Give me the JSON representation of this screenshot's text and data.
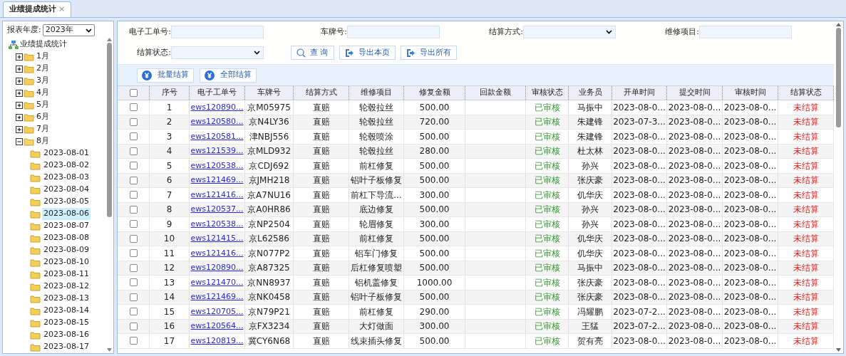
{
  "tabs": [
    {
      "label": "业绩提成统计",
      "close": "×",
      "selected": true
    }
  ],
  "sidebar": {
    "year_label": "报表年度:",
    "year_value": "2023年",
    "tree": {
      "label": "业绩提成统计",
      "selected": false,
      "children": [
        {
          "label": "1月",
          "expanded": false,
          "selected": false
        },
        {
          "label": "2月",
          "expanded": false,
          "selected": false
        },
        {
          "label": "3月",
          "expanded": false,
          "selected": false
        },
        {
          "label": "4月",
          "expanded": false,
          "selected": false
        },
        {
          "label": "5月",
          "expanded": false,
          "selected": false
        },
        {
          "label": "6月",
          "expanded": false,
          "selected": false
        },
        {
          "label": "7月",
          "expanded": false,
          "selected": false
        },
        {
          "label": "8月",
          "expanded": true,
          "selected": false,
          "children": [
            {
              "label": "2023-08-01",
              "selected": false
            },
            {
              "label": "2023-08-02",
              "selected": false
            },
            {
              "label": "2023-08-03",
              "selected": false
            },
            {
              "label": "2023-08-04",
              "selected": false
            },
            {
              "label": "2023-08-05",
              "selected": false
            },
            {
              "label": "2023-08-06",
              "selected": true
            },
            {
              "label": "2023-08-07",
              "selected": false
            },
            {
              "label": "2023-08-08",
              "selected": false
            },
            {
              "label": "2023-08-09",
              "selected": false
            },
            {
              "label": "2023-08-10",
              "selected": false
            },
            {
              "label": "2023-08-11",
              "selected": false
            },
            {
              "label": "2023-08-12",
              "selected": false
            },
            {
              "label": "2023-08-13",
              "selected": false
            },
            {
              "label": "2023-08-14",
              "selected": false
            },
            {
              "label": "2023-08-15",
              "selected": false
            },
            {
              "label": "2023-08-16",
              "selected": false
            },
            {
              "label": "2023-08-17",
              "selected": false
            }
          ]
        }
      ]
    }
  },
  "filters": [
    {
      "label": "电子工单号:",
      "kind": "text"
    },
    {
      "label": "车牌号:",
      "kind": "text"
    },
    {
      "label": "结算方式:",
      "kind": "select"
    },
    {
      "label": "维修项目:",
      "kind": "text"
    },
    {
      "label": "结算状态:",
      "kind": "select"
    }
  ],
  "filter_buttons": [
    {
      "label": "查 询",
      "kind": "search"
    },
    {
      "label": "导出本页",
      "kind": "export"
    },
    {
      "label": "导出所有",
      "kind": "export"
    }
  ],
  "toolbar": [
    {
      "label": "批量结算"
    },
    {
      "label": "全部结算"
    }
  ],
  "table": {
    "select_all_checked": false,
    "columns": [
      "序号",
      "电子工单号",
      "车牌号",
      "结算方式",
      "维修项目",
      "修复金额",
      "回款金额",
      "审核状态",
      "业务员",
      "开单时间",
      "提交时间",
      "审核时间",
      "结算状态"
    ],
    "rows": [
      {
        "checked": false,
        "cells": [
          "1",
          "ews120890...",
          "京M05975",
          "直赔",
          "轮毂拉丝",
          "500.00",
          "",
          "已审核",
          "马振中",
          "2023-08-0...",
          "2023-08-0...",
          "2023-08-0...",
          "未结算"
        ]
      },
      {
        "checked": false,
        "cells": [
          "2",
          "ews120580...",
          "京N4LY36",
          "直赔",
          "轮毂拉丝",
          "720.00",
          "",
          "已审核",
          "朱建锋",
          "2023-07-3...",
          "2023-08-0...",
          "2023-08-0...",
          "未结算"
        ]
      },
      {
        "checked": false,
        "cells": [
          "3",
          "ews120581...",
          "津NBJ556",
          "直赔",
          "轮毂喷涂",
          "500.00",
          "",
          "已审核",
          "朱建锋",
          "2023-08-0...",
          "2023-08-0...",
          "2023-08-0...",
          "未结算"
        ]
      },
      {
        "checked": false,
        "cells": [
          "4",
          "ews121539...",
          "京MLD932",
          "直赔",
          "轮毂拉丝",
          "280.00",
          "",
          "已审核",
          "杜太林",
          "2023-08-0...",
          "2023-08-0...",
          "2023-08-0...",
          "未结算"
        ]
      },
      {
        "checked": false,
        "cells": [
          "5",
          "ews120538...",
          "京CDJ692",
          "直赔",
          "前杠修复",
          "500.00",
          "",
          "已审核",
          "孙兴",
          "2023-08-0...",
          "2023-08-0...",
          "2023-08-0...",
          "未结算"
        ]
      },
      {
        "checked": false,
        "cells": [
          "6",
          "ews121469...",
          "京JMH218",
          "直赔",
          "铝叶子板修复",
          "500.00",
          "",
          "已审核",
          "张庆豪",
          "2023-08-0...",
          "2023-08-0...",
          "2023-08-0...",
          "未结算"
        ]
      },
      {
        "checked": false,
        "cells": [
          "7",
          "ews121416...",
          "京A7NU16",
          "直赔",
          "前杠下导流...",
          "300.00",
          "",
          "已审核",
          "仉华庆",
          "2023-08-0...",
          "2023-08-0...",
          "2023-08-0...",
          "未结算"
        ]
      },
      {
        "checked": false,
        "cells": [
          "8",
          "ews120537...",
          "京A0HR86",
          "直赔",
          "底边修复",
          "500.00",
          "",
          "已审核",
          "孙兴",
          "2023-08-0...",
          "2023-08-0...",
          "2023-08-0...",
          "未结算"
        ]
      },
      {
        "checked": false,
        "cells": [
          "9",
          "ews120538...",
          "京NP2504",
          "直赔",
          "轮眉修复",
          "300.00",
          "",
          "已审核",
          "孙兴",
          "2023-08-0...",
          "2023-08-0...",
          "2023-08-0...",
          "未结算"
        ]
      },
      {
        "checked": false,
        "cells": [
          "10",
          "ews121415...",
          "京L62586",
          "直赔",
          "前杠修复",
          "500.00",
          "",
          "已审核",
          "仉华庆",
          "2023-08-0...",
          "2023-08-0...",
          "2023-08-0...",
          "未结算"
        ]
      },
      {
        "checked": false,
        "cells": [
          "11",
          "ews121416...",
          "京N077P2",
          "直赔",
          "铝车门修复",
          "500.00",
          "",
          "已审核",
          "仉华庆",
          "2023-08-0...",
          "2023-08-0...",
          "2023-08-0...",
          "未结算"
        ]
      },
      {
        "checked": false,
        "cells": [
          "12",
          "ews120890...",
          "京A87325",
          "直赔",
          "后杠修复喷塑",
          "500.00",
          "",
          "已审核",
          "马振中",
          "2023-08-0...",
          "2023-08-0...",
          "2023-08-0...",
          "未结算"
        ]
      },
      {
        "checked": false,
        "cells": [
          "13",
          "ews121470...",
          "京NN8937",
          "直赔",
          "铝机盖修复",
          "1000.00",
          "",
          "已审核",
          "张庆豪",
          "2023-08-0...",
          "2023-08-0...",
          "2023-08-0...",
          "未结算"
        ]
      },
      {
        "checked": false,
        "cells": [
          "14",
          "ews121469...",
          "京NK0458",
          "直赔",
          "铝叶子板修复",
          "500.00",
          "",
          "已审核",
          "张庆豪",
          "2023-08-0...",
          "2023-08-0...",
          "2023-08-0...",
          "未结算"
        ]
      },
      {
        "checked": false,
        "cells": [
          "15",
          "ews120705...",
          "京N79P21",
          "直赔",
          "前杠修复",
          "290.00",
          "",
          "已审核",
          "冯耀鹏",
          "2023-07-2...",
          "2023-08-0...",
          "2023-08-0...",
          "未结算"
        ]
      },
      {
        "checked": false,
        "cells": [
          "16",
          "ews120564...",
          "京FX3234",
          "直赔",
          "大灯做面",
          "300.00",
          "",
          "已审核",
          "王猛",
          "2023-07-2...",
          "2023-08-0...",
          "2023-08-0...",
          "未结算"
        ]
      },
      {
        "checked": false,
        "cells": [
          "17",
          "ews120819...",
          "冀CY6N68",
          "直赔",
          "线束插头修复",
          "500.00",
          "",
          "已审核",
          "贺有亮",
          "2023-08-0...",
          "2023-08-0...",
          "2023-08-0...",
          "未结算"
        ]
      }
    ]
  }
}
